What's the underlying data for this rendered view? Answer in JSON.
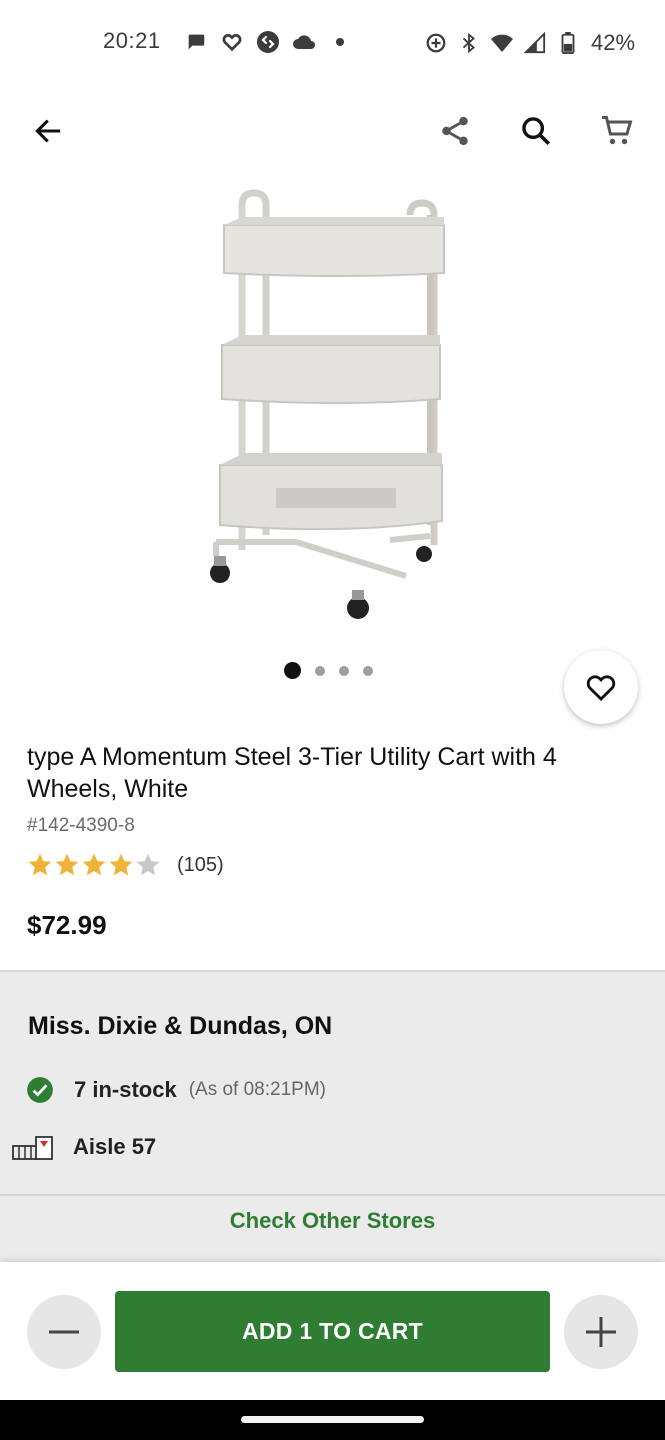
{
  "status_bar": {
    "time": "20:21",
    "battery": "42%",
    "left_icons": [
      "chat-icon",
      "heart-icon",
      "shazam-icon",
      "cloud-icon",
      "dot-icon"
    ],
    "right_icons": [
      "data-saver-icon",
      "bluetooth-icon",
      "wifi-icon",
      "signal-icon",
      "battery-icon"
    ]
  },
  "toolbar": {
    "back_icon": "arrow-back-icon",
    "share_icon": "share-icon",
    "search_icon": "search-icon",
    "cart_icon": "cart-icon"
  },
  "product": {
    "image_icon": "utility-cart-image",
    "carousel": {
      "count": 4,
      "active_index": 0
    },
    "title": "type A Momentum Steel 3-Tier Utility Cart with 4 Wheels, White",
    "sku": "#142-4390-8",
    "rating": {
      "value": 4,
      "max": 5,
      "count_label": "(105)"
    },
    "price": "$72.99"
  },
  "store": {
    "name": "Miss. Dixie & Dundas, ON",
    "stock_label": "7 in-stock",
    "stock_asof": "(As of 08:21PM)",
    "aisle_label": "Aisle 57",
    "check_other_label": "Check Other Stores"
  },
  "action_bar": {
    "add_label": "ADD 1 TO CART"
  },
  "colors": {
    "brand_green": "#2e7d32",
    "star_gold": "#f0b33a",
    "store_bg": "#ebebeb"
  }
}
